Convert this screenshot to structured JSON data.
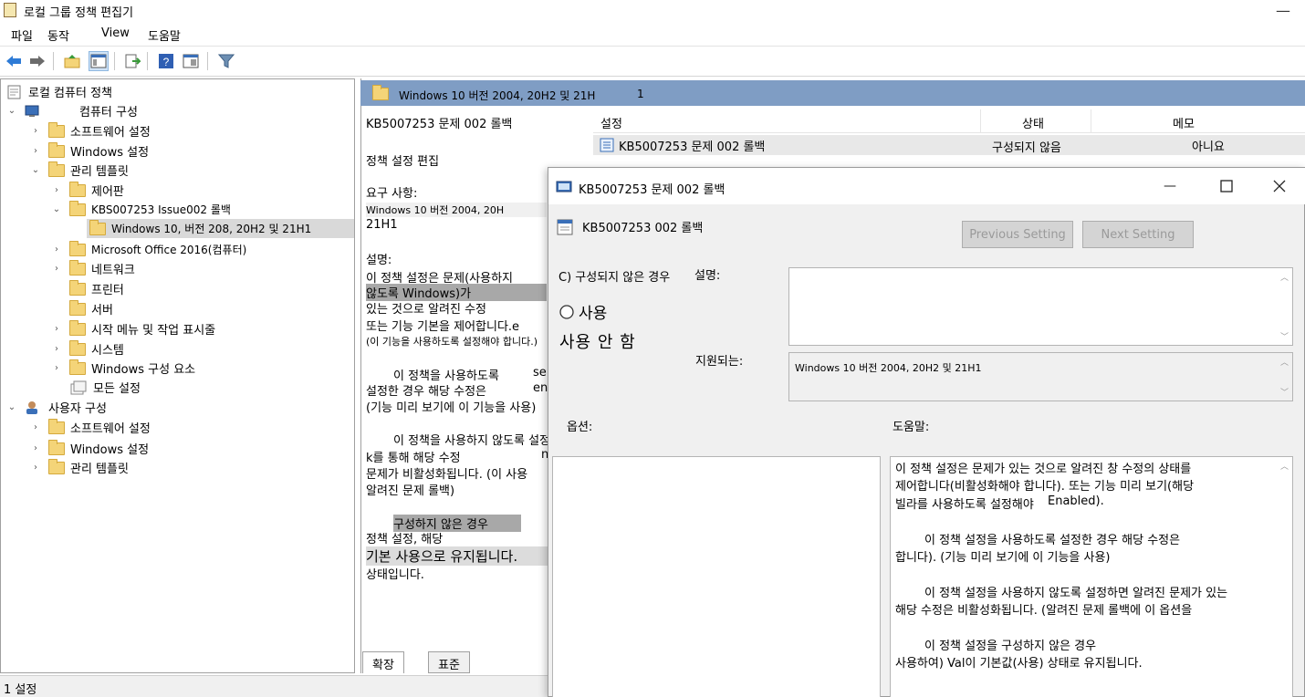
{
  "window": {
    "title": "로컬 그룹 정책 편집기",
    "minimize_glyph": "—"
  },
  "menu": {
    "items": [
      "파일",
      "동작",
      "View",
      "도움말"
    ]
  },
  "tree": {
    "root": "로컬 컴퓨터 정책",
    "computer_config": "컴퓨터 구성",
    "software_settings": "소프트웨어 설정",
    "windows_settings": "Windows 설정",
    "admin_templates": "관리 템플릿",
    "control_panel": "제어판",
    "kb_issue": "KBS007253  Issue002 롤백",
    "win10_folder": "Windows 10, 버전 208, 20H2 및 21H1",
    "office": "Microsoft Office 2016(컴퓨터)",
    "network": "네트워크",
    "printer": "프린터",
    "server": "서버",
    "start_menu": "시작 메뉴 및 작업 표시줄",
    "system": "시스템",
    "windows_components": "Windows 구성 요소",
    "all_settings": "모든 설정",
    "user_config": "사용자 구성",
    "user_software": "소프트웨어 설정",
    "user_windows": "Windows 설정",
    "user_admin": "관리 템플릿"
  },
  "middle": {
    "header_title": "Windows 10 버전 2004, 20H2 및 21H",
    "header_suffix": "1",
    "policy_title": "KB5007253 문제 002 롤백",
    "edit_link": "정책 설정 편집",
    "requirements_label": "요구 사항:",
    "requirements_value": "Windows 10 버전 2004, 20H",
    "requirements_cont": "21H1",
    "description_label": "설명:",
    "desc_lines": [
      "이 정책 설정은 문제(사용하지",
      "않도록 Windows)가",
      "있는 것으로 알려진 수정",
      "또는 기능 기본을 제어합니다.e",
      "(이 기능을 사용하도록 설정해야 합니다.)",
      "이 정책을 사용하도록",
      "se",
      "설정한 경우 해당 수정은",
      "en",
      "(기능 미리 보기에 이 기능을 사용)",
      "이 정책을 사용하지 않도록 설정하는 경우",
      "k를 통해 해당 수정",
      "n",
      "문제가 비활성화됩니다. (이 사용",
      "알려진 문제 롤백)",
      "구성하지 않은 경우",
      "정책 설정, 해당",
      "기본 사용으로 유지됩니다.",
      "상태입니다."
    ],
    "tabs": [
      "확장",
      "표준"
    ]
  },
  "list": {
    "col_setting": "설정",
    "col_state": "상태",
    "col_comment": "메모",
    "row_name": "KB5007253 문제 002 롤백",
    "row_state": "구성되지 않음",
    "row_comment": "아니요"
  },
  "status": {
    "text": "1 설정"
  },
  "dialog": {
    "title": "KB5007253 문제 002 롤백",
    "subtitle": "KB5007253  002 롤백",
    "prev_button": "Previous Setting",
    "next_button": "Next Setting",
    "not_configured": "C) 구성되지 않은 경우",
    "comment_label": "설명:",
    "enabled_label": "사용",
    "disabled_label": "사용 안 함",
    "supported_label": "지원되는:",
    "supported_value": "Windows 10 버전 2004, 20H2 및 21H1",
    "options_label": "옵션:",
    "help_label": "도움말:",
    "help_lines": [
      "이 정책 설정은 문제가 있는 것으로 알려진 창 수정의 상태를",
      "제어합니다(비활성화해야 합니다). 또는 기능 미리 보기(해당",
      "빌라를 사용하도록 설정해야",
      "Enabled).",
      "이 정책 설정을 사용하도록 설정한 경우 해당 수정은",
      "합니다). (기능 미리 보기에 이 기능을 사용)",
      "이 정책 설정을 사용하지 않도록 설정하면 알려진 문제가 있는",
      "해당 수정은 비활성화됩니다. (알려진 문제 롤백에 이 옵션을",
      "이 정책 설정을 구성하지 않은 경우",
      "사용하여) Val이 기본값(사용) 상태로 유지됩니다."
    ]
  },
  "colors": {
    "header_blue": "#7f9dc4",
    "folder_yellow": "#f4d478",
    "selection_gray": "#d9d9d9",
    "dialog_bg": "#f0f0f0"
  }
}
